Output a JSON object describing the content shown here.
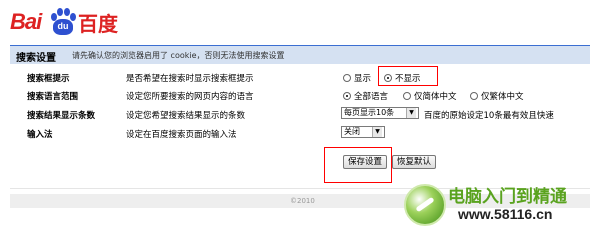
{
  "logo": {
    "text_latin": "Bai",
    "paw_text": "du",
    "text_cn": "百度"
  },
  "header": {
    "title": "搜索设置",
    "note": "请先确认您的浏览器启用了 cookie，否则无法使用搜索设置"
  },
  "rows": [
    {
      "label": "搜索框提示",
      "desc": "是否希望在搜索时显示搜索框提示",
      "options": [
        {
          "label": "显示",
          "selected": false
        },
        {
          "label": "不显示",
          "selected": true
        }
      ]
    },
    {
      "label": "搜索语言范围",
      "desc": "设定您所要搜索的网页内容的语言",
      "options": [
        {
          "label": "全部语言",
          "selected": true
        },
        {
          "label": "仅简体中文",
          "selected": false
        },
        {
          "label": "仅繁体中文",
          "selected": false
        }
      ]
    },
    {
      "label": "搜索结果显示条数",
      "desc": "设定您希望搜索结果显示的条数",
      "select": "每页显示10条",
      "select_note": "百度的原始设定10条最有效且快速"
    },
    {
      "label": "输入法",
      "desc": "设定在百度搜索页面的输入法",
      "select": "关闭"
    }
  ],
  "buttons": {
    "save": "保存设置",
    "reset": "恢复默认"
  },
  "footer": {
    "text": "©2010"
  },
  "watermark": {
    "title": "电脑入门到精通",
    "url": "www.58116.cn"
  },
  "colors": {
    "brand_red": "#dd2222",
    "brand_blue": "#2e50d0",
    "header_bar": "#d5e1f2",
    "highlight": "#ff0000",
    "watermark_green": "#5aa31f"
  }
}
